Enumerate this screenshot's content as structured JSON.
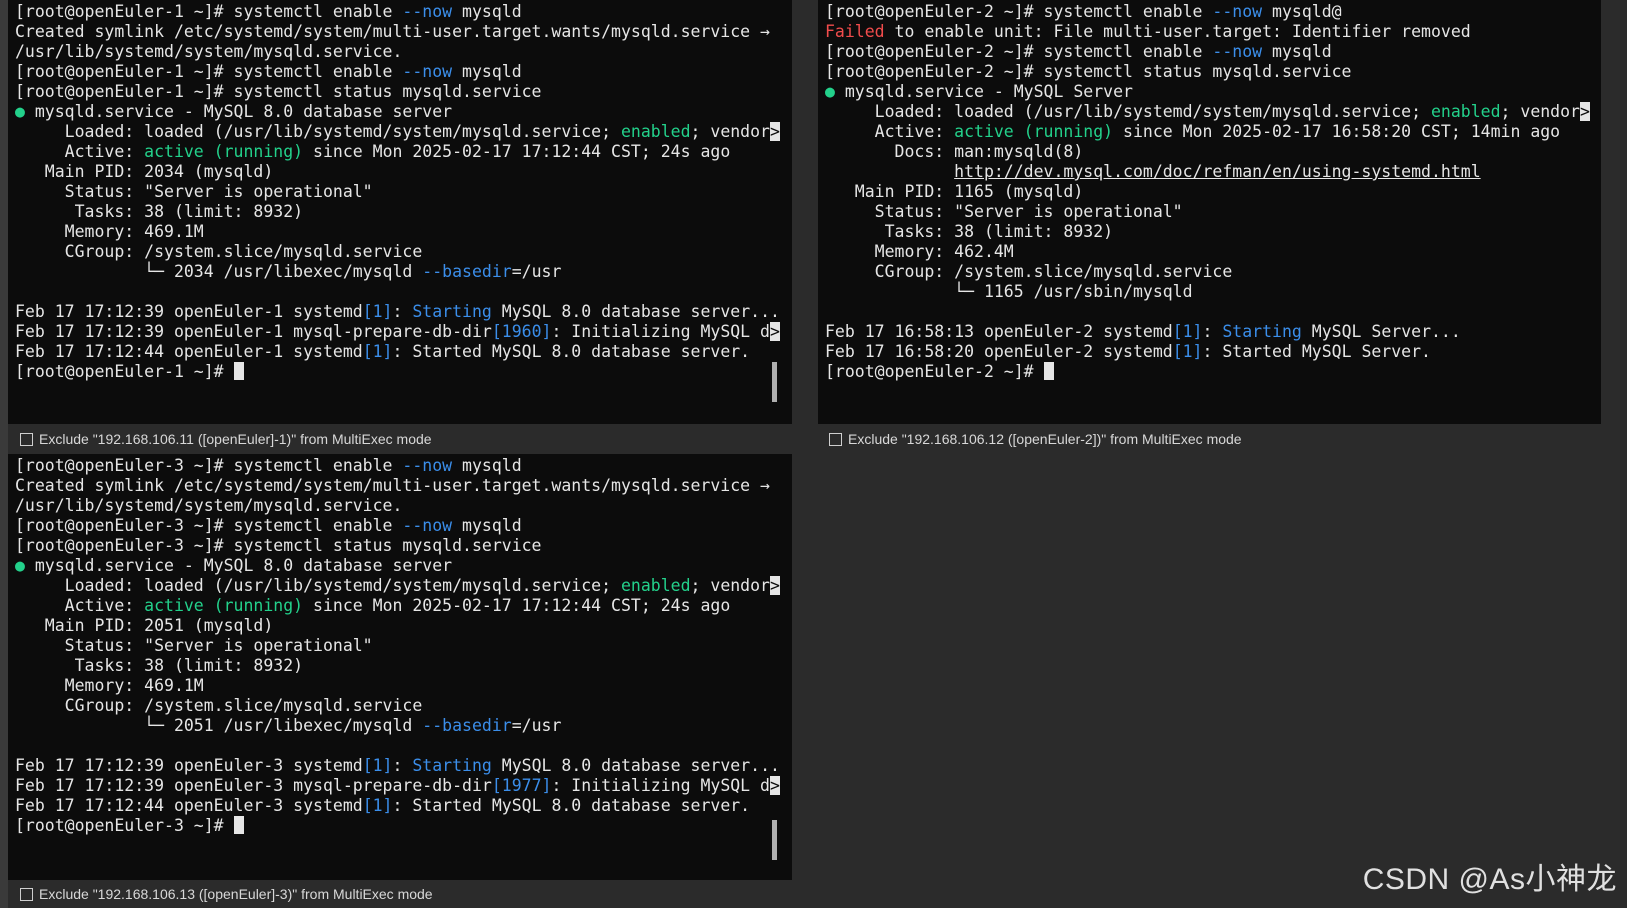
{
  "colors": {
    "blue": "#3b8eea",
    "green": "#23d18b",
    "red": "#f14c4c",
    "bg": "#0c0c0c"
  },
  "pane1": {
    "lines": [
      [
        {
          "t": "[root@openEuler-1 ~]# systemctl enable "
        },
        {
          "t": "--now",
          "c": "blue"
        },
        {
          "t": " mysqld"
        }
      ],
      [
        {
          "t": "Created symlink /etc/systemd/system/multi-user.target.wants/mysqld.service → "
        }
      ],
      [
        {
          "t": "/usr/lib/systemd/system/mysqld.service."
        }
      ],
      [
        {
          "t": "[root@openEuler-1 ~]# systemctl enable "
        },
        {
          "t": "--now",
          "c": "blue"
        },
        {
          "t": " mysqld"
        }
      ],
      [
        {
          "t": "[root@openEuler-1 ~]# systemctl status mysqld.service"
        }
      ],
      [
        {
          "t": "●",
          "c": "dot"
        },
        {
          "t": " mysqld.service - MySQL 8.0 database server"
        }
      ],
      [
        {
          "t": "     Loaded: loaded (/usr/lib/systemd/system/mysqld.service; "
        },
        {
          "t": "enabled",
          "c": "green"
        },
        {
          "t": "; vendor"
        },
        {
          "t": ">",
          "c": "trunc"
        }
      ],
      [
        {
          "t": "     Active: "
        },
        {
          "t": "active (running)",
          "c": "green"
        },
        {
          "t": " since Mon 2025-02-17 17:12:44 CST; 24s ago"
        }
      ],
      [
        {
          "t": "   Main PID: 2034 (mysqld)"
        }
      ],
      [
        {
          "t": "     Status: \"Server is operational\""
        }
      ],
      [
        {
          "t": "      Tasks: 38 (limit: 8932)"
        }
      ],
      [
        {
          "t": "     Memory: 469.1M"
        }
      ],
      [
        {
          "t": "     CGroup: /system.slice/mysqld.service"
        }
      ],
      [
        {
          "t": "             └─ 2034 /usr/libexec/mysqld "
        },
        {
          "t": "--basedir",
          "c": "blue"
        },
        {
          "t": "=/usr"
        }
      ],
      [
        {
          "t": ""
        }
      ],
      [
        {
          "t": "Feb 17 17:12:39 openEuler-1 systemd"
        },
        {
          "t": "[1]",
          "c": "blue"
        },
        {
          "t": ": "
        },
        {
          "t": "Starting",
          "c": "blue"
        },
        {
          "t": " MySQL 8.0 database server..."
        }
      ],
      [
        {
          "t": "Feb 17 17:12:39 openEuler-1 mysql-prepare-db-dir"
        },
        {
          "t": "[1960]",
          "c": "blue"
        },
        {
          "t": ": Initializing MySQL d"
        },
        {
          "t": ">",
          "c": "trunc"
        }
      ],
      [
        {
          "t": "Feb 17 17:12:44 openEuler-1 systemd"
        },
        {
          "t": "[1]",
          "c": "blue"
        },
        {
          "t": ": Started MySQL 8.0 database server."
        }
      ],
      [
        {
          "t": "[root@openEuler-1 ~]# "
        },
        {
          "cursor": true
        }
      ]
    ],
    "exclude_label": "Exclude \"192.168.106.11 ([openEuler]-1)\" from MultiExec mode"
  },
  "pane2": {
    "lines": [
      [
        {
          "t": "[root@openEuler-2 ~]# systemctl enable "
        },
        {
          "t": "--now",
          "c": "blue"
        },
        {
          "t": " mysqld@"
        }
      ],
      [
        {
          "t": "Failed",
          "c": "red"
        },
        {
          "t": " to enable unit: File multi-user.target: Identifier removed"
        }
      ],
      [
        {
          "t": "[root@openEuler-2 ~]# systemctl enable "
        },
        {
          "t": "--now",
          "c": "blue"
        },
        {
          "t": " mysqld"
        }
      ],
      [
        {
          "t": "[root@openEuler-2 ~]# systemctl status mysqld.service"
        }
      ],
      [
        {
          "t": "●",
          "c": "dot"
        },
        {
          "t": " mysqld.service - MySQL Server"
        }
      ],
      [
        {
          "t": "     Loaded: loaded (/usr/lib/systemd/system/mysqld.service; "
        },
        {
          "t": "enabled",
          "c": "green"
        },
        {
          "t": "; vendor"
        },
        {
          "t": ">",
          "c": "trunc"
        }
      ],
      [
        {
          "t": "     Active: "
        },
        {
          "t": "active (running)",
          "c": "green"
        },
        {
          "t": " since Mon 2025-02-17 16:58:20 CST; 14min ago"
        }
      ],
      [
        {
          "t": "       Docs: man:mysqld(8)"
        }
      ],
      [
        {
          "t": "             "
        },
        {
          "t": "http://dev.mysql.com/doc/refman/en/using-systemd.html",
          "c": "link"
        }
      ],
      [
        {
          "t": "   Main PID: 1165 (mysqld)"
        }
      ],
      [
        {
          "t": "     Status: \"Server is operational\""
        }
      ],
      [
        {
          "t": "      Tasks: 38 (limit: 8932)"
        }
      ],
      [
        {
          "t": "     Memory: 462.4M"
        }
      ],
      [
        {
          "t": "     CGroup: /system.slice/mysqld.service"
        }
      ],
      [
        {
          "t": "             └─ 1165 /usr/sbin/mysqld"
        }
      ],
      [
        {
          "t": ""
        }
      ],
      [
        {
          "t": "Feb 17 16:58:13 openEuler-2 systemd"
        },
        {
          "t": "[1]",
          "c": "blue"
        },
        {
          "t": ": "
        },
        {
          "t": "Starting",
          "c": "blue"
        },
        {
          "t": " MySQL Server..."
        }
      ],
      [
        {
          "t": "Feb 17 16:58:20 openEuler-2 systemd"
        },
        {
          "t": "[1]",
          "c": "blue"
        },
        {
          "t": ": Started MySQL Server."
        }
      ],
      [
        {
          "t": "[root@openEuler-2 ~]# "
        },
        {
          "cursor": true
        }
      ]
    ],
    "exclude_label": "Exclude \"192.168.106.12 ([openEuler-2])\" from MultiExec mode"
  },
  "pane3": {
    "lines": [
      [
        {
          "t": "[root@openEuler-3 ~]# systemctl enable "
        },
        {
          "t": "--now",
          "c": "blue"
        },
        {
          "t": " mysqld"
        }
      ],
      [
        {
          "t": "Created symlink /etc/systemd/system/multi-user.target.wants/mysqld.service → "
        }
      ],
      [
        {
          "t": "/usr/lib/systemd/system/mysqld.service."
        }
      ],
      [
        {
          "t": "[root@openEuler-3 ~]# systemctl enable "
        },
        {
          "t": "--now",
          "c": "blue"
        },
        {
          "t": " mysqld"
        }
      ],
      [
        {
          "t": "[root@openEuler-3 ~]# systemctl status mysqld.service"
        }
      ],
      [
        {
          "t": "●",
          "c": "dot"
        },
        {
          "t": " mysqld.service - MySQL 8.0 database server"
        }
      ],
      [
        {
          "t": "     Loaded: loaded (/usr/lib/systemd/system/mysqld.service; "
        },
        {
          "t": "enabled",
          "c": "green"
        },
        {
          "t": "; vendor"
        },
        {
          "t": ">",
          "c": "trunc"
        }
      ],
      [
        {
          "t": "     Active: "
        },
        {
          "t": "active (running)",
          "c": "green"
        },
        {
          "t": " since Mon 2025-02-17 17:12:44 CST; 24s ago"
        }
      ],
      [
        {
          "t": "   Main PID: 2051 (mysqld)"
        }
      ],
      [
        {
          "t": "     Status: \"Server is operational\""
        }
      ],
      [
        {
          "t": "      Tasks: 38 (limit: 8932)"
        }
      ],
      [
        {
          "t": "     Memory: 469.1M"
        }
      ],
      [
        {
          "t": "     CGroup: /system.slice/mysqld.service"
        }
      ],
      [
        {
          "t": "             └─ 2051 /usr/libexec/mysqld "
        },
        {
          "t": "--basedir",
          "c": "blue"
        },
        {
          "t": "=/usr"
        }
      ],
      [
        {
          "t": ""
        }
      ],
      [
        {
          "t": "Feb 17 17:12:39 openEuler-3 systemd"
        },
        {
          "t": "[1]",
          "c": "blue"
        },
        {
          "t": ": "
        },
        {
          "t": "Starting",
          "c": "blue"
        },
        {
          "t": " MySQL 8.0 database server..."
        }
      ],
      [
        {
          "t": "Feb 17 17:12:39 openEuler-3 mysql-prepare-db-dir"
        },
        {
          "t": "[1977]",
          "c": "blue"
        },
        {
          "t": ": Initializing MySQL d"
        },
        {
          "t": ">",
          "c": "trunc"
        }
      ],
      [
        {
          "t": "Feb 17 17:12:44 openEuler-3 systemd"
        },
        {
          "t": "[1]",
          "c": "blue"
        },
        {
          "t": ": Started MySQL 8.0 database server."
        }
      ],
      [
        {
          "t": "[root@openEuler-3 ~]# "
        },
        {
          "cursor": true
        }
      ]
    ],
    "exclude_label": "Exclude \"192.168.106.13 ([openEuler]-3)\" from MultiExec mode"
  },
  "watermark": "CSDN @As小神龙"
}
